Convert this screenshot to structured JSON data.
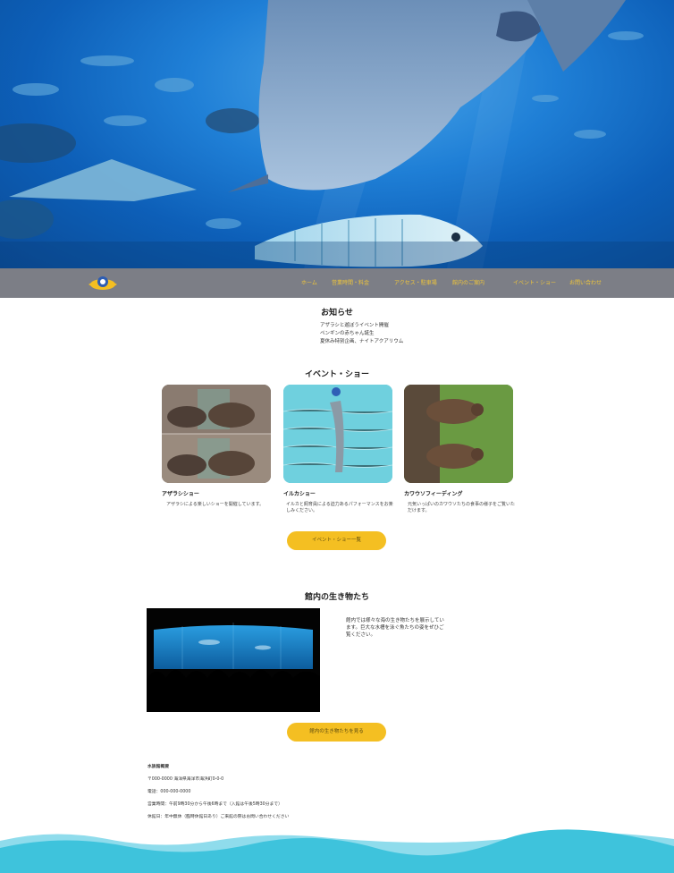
{
  "hero": {
    "icon": "manta-ray-photo"
  },
  "nav": {
    "logo": "logo-icon",
    "items": [
      "ホーム",
      "営業時間・料金",
      "アクセス・駐車場",
      "館内のご案内",
      "イベント・ショー",
      "お問い合わせ"
    ]
  },
  "news": {
    "title": "お知らせ",
    "lines": [
      "アザラシと遊ぼうイベント開催",
      "ペンギンの赤ちゃん誕生",
      "夏休み特別企画、ナイトアクアリウム"
    ]
  },
  "events": {
    "title": "イベント・ショー",
    "cards": [
      {
        "image": "sea-lion-photo",
        "title": "アザラシショー",
        "desc": "アザラシによる楽しいショーを開催しています。"
      },
      {
        "image": "dolphin-photo",
        "title": "イルカショー",
        "desc": "イルカと飼育員による迫力あるパフォーマンスをお楽しみください。"
      },
      {
        "image": "otter-photo",
        "title": "カワウソフィーディング",
        "desc": "元気いっぱいのカワウソたちの食事の様子をご覧いただけます。"
      }
    ],
    "button": "イベント・ショー一覧"
  },
  "creatures": {
    "title": "館内の生き物たち",
    "video": "aquarium-tank-photo",
    "text": "館内では様々な海の生き物たちを展示しています。巨大な水槽を泳ぐ魚たちの姿をぜひご覧ください。",
    "button": "館内の生き物たちを見る"
  },
  "footer": {
    "lines": [
      "水族館概要",
      "〒000-0000 海洋県海洋市海浜町0-0-0",
      "電話：000-000-0000",
      "営業時間：午前9時30分から午後6時まで（入館は午後5時30分まで）",
      "休館日：年中無休（臨時休館日あり）ご来館の際はお問い合わせください"
    ]
  },
  "colors": {
    "accent": "#f4bf22",
    "nav": "#7c7e86",
    "wave": "#3ec3dc"
  }
}
